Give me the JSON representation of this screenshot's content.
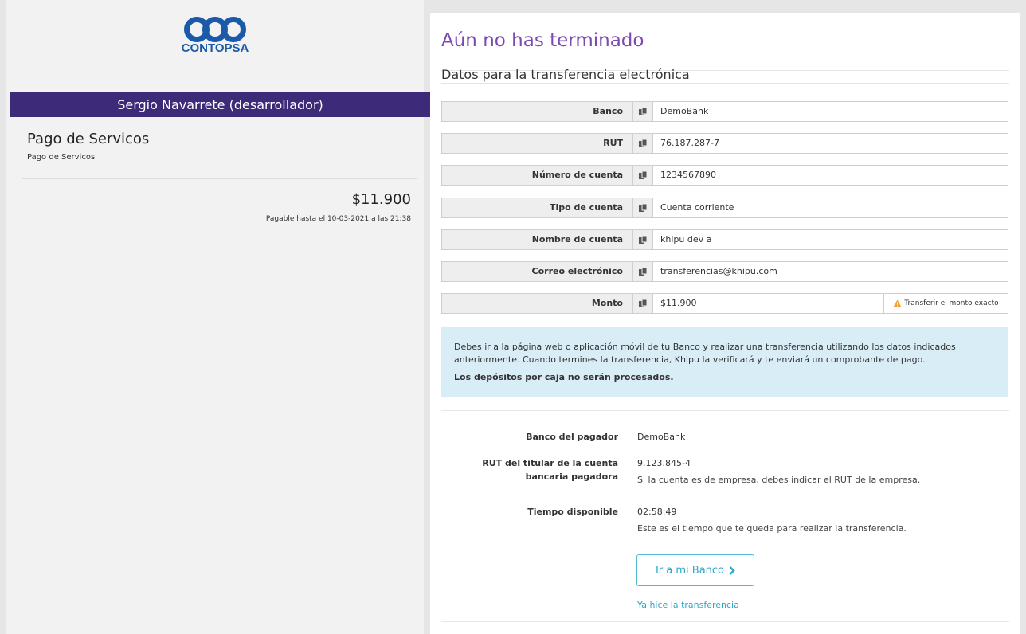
{
  "brand": {
    "logo_text": "CONTOPSA",
    "color": "#1a5aa8"
  },
  "merchant": {
    "name": "Sergio Navarrete (desarrollador)",
    "bar_color": "#3d2a78"
  },
  "service": {
    "title": "Pago de Servicos",
    "subtitle": "Pago de Servicos"
  },
  "payment": {
    "amount": "$11.900",
    "due": "Pagable hasta el 10-03-2021 a las 21:38"
  },
  "main": {
    "title": "Aún no has terminado",
    "title_color": "#7b4bb4",
    "section_title": "Datos para la transferencia electrónica"
  },
  "transfer_fields": [
    {
      "label": "Banco",
      "value": "DemoBank"
    },
    {
      "label": "RUT",
      "value": "76.187.287-7"
    },
    {
      "label": "Número de cuenta",
      "value": "1234567890"
    },
    {
      "label": "Tipo de cuenta",
      "value": "Cuenta corriente"
    },
    {
      "label": "Nombre de cuenta",
      "value": "khipu dev a"
    },
    {
      "label": "Correo electrónico",
      "value": "transferencias@khipu.com"
    },
    {
      "label": "Monto",
      "value": "$11.900",
      "warning": "Transferir el monto exacto"
    }
  ],
  "info": {
    "text": "Debes ir a la página web o aplicación móvil de tu Banco y realizar una transferencia utilizando los datos indicados anteriormente. Cuando termines la transferencia, Khipu la verificará y te enviará un comprobante de pago.",
    "bold": "Los depósitos por caja no serán procesados.",
    "bg_color": "#d9edf7"
  },
  "payer": {
    "bank_label": "Banco del pagador",
    "bank_value": "DemoBank",
    "rut_label": "RUT del titular de la cuenta bancaria pagadora",
    "rut_value": "9.123.845-4",
    "rut_help": "Si la cuenta es de empresa, debes indicar el RUT de la empresa.",
    "time_label": "Tiempo disponible",
    "time_value": "02:58:49",
    "time_help": "Este es el tiempo que te queda para realizar la transferencia."
  },
  "actions": {
    "bank_button": "Ir a mi Banco",
    "done_link": "Ya hice la transferencia",
    "accent_color": "#2ea6c4"
  }
}
